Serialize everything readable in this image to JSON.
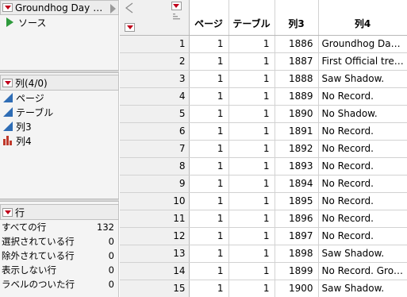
{
  "table_panel": {
    "title": "Groundhog Day",
    "title_ellipsis": "…",
    "source_label": "ソース"
  },
  "columns_panel": {
    "title": "列(4/0)",
    "items": [
      {
        "label": "ページ",
        "icon": "continuous-icon"
      },
      {
        "label": "テーブル",
        "icon": "continuous-icon"
      },
      {
        "label": "列3",
        "icon": "continuous-icon"
      },
      {
        "label": "列4",
        "icon": "nominal-icon"
      }
    ]
  },
  "rows_panel": {
    "title": "行",
    "items": [
      {
        "label": "すべての行",
        "value": "132"
      },
      {
        "label": "選択されている行",
        "value": "0"
      },
      {
        "label": "除外されている行",
        "value": "0"
      },
      {
        "label": "表示しない行",
        "value": "0"
      },
      {
        "label": "ラベルのついた行",
        "value": "0"
      }
    ]
  },
  "grid": {
    "headers": [
      "ページ",
      "テーブル",
      "列3",
      "列4"
    ],
    "rows": [
      [
        "1",
        "1",
        "1",
        "1886",
        "Groundhog Da…"
      ],
      [
        "2",
        "1",
        "1",
        "1887",
        "First Official tre…"
      ],
      [
        "3",
        "1",
        "1",
        "1888",
        "Saw Shadow."
      ],
      [
        "4",
        "1",
        "1",
        "1889",
        "No Record."
      ],
      [
        "5",
        "1",
        "1",
        "1890",
        "No Shadow."
      ],
      [
        "6",
        "1",
        "1",
        "1891",
        "No Record."
      ],
      [
        "7",
        "1",
        "1",
        "1892",
        "No Record."
      ],
      [
        "8",
        "1",
        "1",
        "1893",
        "No Record."
      ],
      [
        "9",
        "1",
        "1",
        "1894",
        "No Record."
      ],
      [
        "10",
        "1",
        "1",
        "1895",
        "No Record."
      ],
      [
        "11",
        "1",
        "1",
        "1896",
        "No Record."
      ],
      [
        "12",
        "1",
        "1",
        "1897",
        "No Record."
      ],
      [
        "13",
        "1",
        "1",
        "1898",
        "Saw Shadow."
      ],
      [
        "14",
        "1",
        "1",
        "1899",
        "No Record. Gro…"
      ],
      [
        "15",
        "1",
        "1",
        "1900",
        "Saw Shadow."
      ]
    ]
  },
  "colors": {
    "menu_triangle": "#c0001a",
    "continuous_icon": "#2f6db5",
    "nominal_icon": "#c0392b",
    "source_play": "#2e9a3c"
  }
}
